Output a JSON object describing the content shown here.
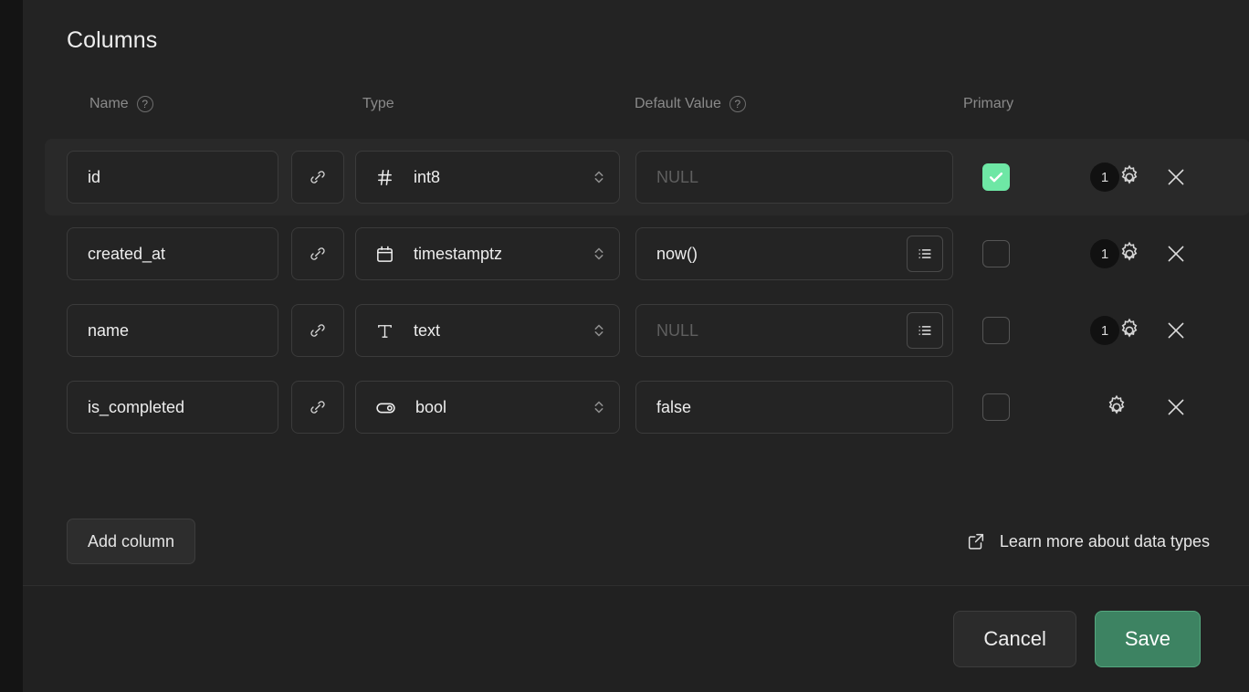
{
  "dialog": {
    "section_title": "Columns",
    "headers": {
      "name": "Name",
      "type": "Type",
      "default_value": "Default Value",
      "primary": "Primary",
      "help_glyph": "?"
    },
    "columns": [
      {
        "name": "id",
        "type": "int8",
        "type_icon": "hash-icon",
        "default_value": "",
        "default_placeholder": "NULL",
        "has_list_button": false,
        "primary": true,
        "badge_count": "1",
        "has_badge": true
      },
      {
        "name": "created_at",
        "type": "timestamptz",
        "type_icon": "calendar-icon",
        "default_value": "now()",
        "default_placeholder": "",
        "has_list_button": true,
        "primary": false,
        "badge_count": "1",
        "has_badge": true
      },
      {
        "name": "name",
        "type": "text",
        "type_icon": "text-icon",
        "default_value": "",
        "default_placeholder": "NULL",
        "has_list_button": true,
        "primary": false,
        "badge_count": "1",
        "has_badge": true
      },
      {
        "name": "is_completed",
        "type": "bool",
        "type_icon": "toggle-icon",
        "default_value": "false",
        "default_placeholder": "",
        "has_list_button": false,
        "primary": false,
        "badge_count": "",
        "has_badge": false
      }
    ],
    "add_column_label": "Add column",
    "learn_more_label": "Learn more about data types",
    "cancel_label": "Cancel",
    "save_label": "Save"
  },
  "colors": {
    "panel_bg": "#232323",
    "row_highlight": "#292929",
    "field_bg": "#242424",
    "field_border": "#3b3b3b",
    "accent_check": "#6ee7a5",
    "save_green": "#3d8362",
    "save_border": "#55a87f",
    "text_primary": "#ededed",
    "text_muted": "#8a8a8a",
    "placeholder": "#5f5f5f"
  }
}
